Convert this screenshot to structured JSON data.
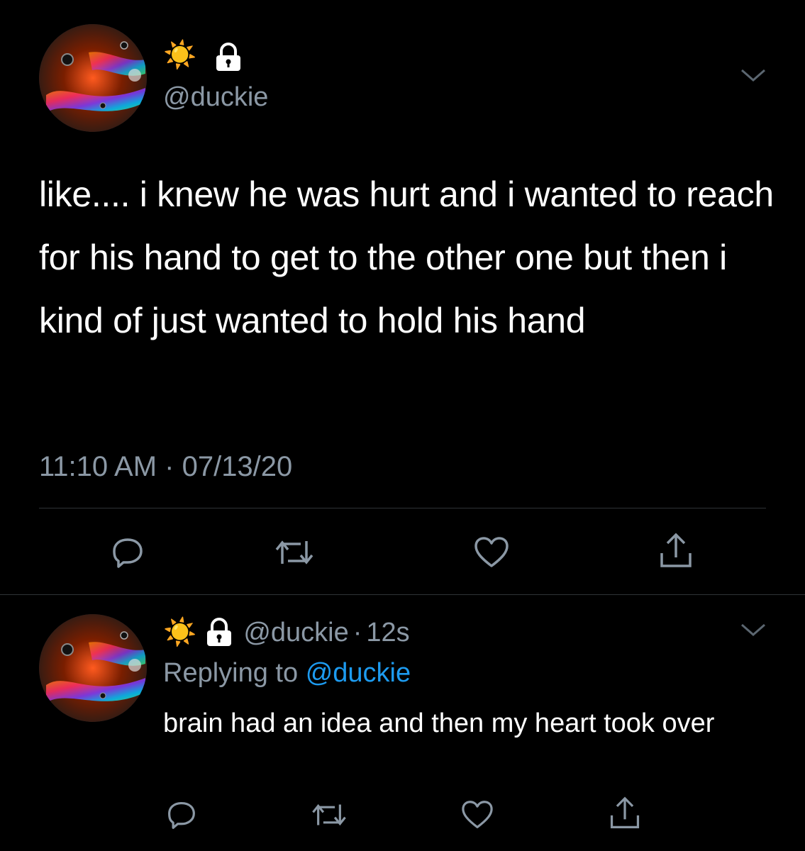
{
  "colors": {
    "background": "#000000",
    "text": "#ffffff",
    "muted": "#8b98a5",
    "accent": "#1d9bf0",
    "divider": "#2f3336"
  },
  "main_tweet": {
    "name_emoji": "☀️",
    "handle": "@duckie",
    "text": "like.... i knew he was hurt and i wanted to reach for his hand to get to the other one but then i kind of just wanted to hold his hand",
    "timestamp": "11:10 AM · 07/13/20",
    "icons": {
      "more": "chevron-down-icon",
      "lock": "lock-icon"
    }
  },
  "reply_tweet": {
    "name_emoji": "☀️",
    "handle": "@duckie",
    "sep": "·",
    "time": "12s",
    "replying_to_label": "Replying to",
    "replying_to_handle": "@duckie",
    "text": "brain had an idea and then my heart took over"
  },
  "actions": [
    "reply-icon",
    "retweet-icon",
    "like-icon",
    "share-icon"
  ]
}
